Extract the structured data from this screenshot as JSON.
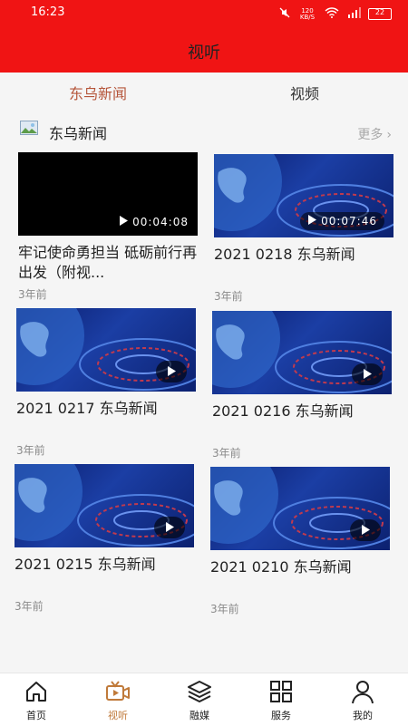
{
  "status_bar": {
    "time": "16:23",
    "net_speed": "120 KB/S",
    "battery": "22"
  },
  "header": {
    "title": "视听"
  },
  "tabs": [
    {
      "label": "东乌新闻",
      "active": true
    },
    {
      "label": "视频",
      "active": false
    }
  ],
  "section": {
    "title": "东乌新闻",
    "more_label": "更多",
    "icon": "image-icon"
  },
  "videos": [
    {
      "title": "牢记使命勇担当  砥砺前行再出发（附视...",
      "meta": "3年前",
      "duration": "00:04:08",
      "thumb": "black"
    },
    {
      "title": "2021  0218  东乌新闻",
      "meta": "3年前",
      "duration": "00:07:46",
      "thumb": "globe"
    },
    {
      "title": "2021  0217  东乌新闻",
      "meta": "3年前",
      "duration": "",
      "thumb": "globe"
    },
    {
      "title": "2021  0216  东乌新闻",
      "meta": "3年前",
      "duration": "",
      "thumb": "globe"
    },
    {
      "title": "2021  0215  东乌新闻",
      "meta": "3年前",
      "duration": "",
      "thumb": "globe"
    },
    {
      "title": "2021  0210  东乌新闻",
      "meta": "3年前",
      "duration": "",
      "thumb": "globe"
    }
  ],
  "bottom_nav": [
    {
      "label": "首页",
      "icon": "home-icon",
      "active": false
    },
    {
      "label": "视听",
      "icon": "video-icon",
      "active": true
    },
    {
      "label": "融媒",
      "icon": "layers-icon",
      "active": false
    },
    {
      "label": "服务",
      "icon": "grid-icon",
      "active": false
    },
    {
      "label": "我的",
      "icon": "user-icon",
      "active": false
    }
  ],
  "colors": {
    "header": "#f01414",
    "accent": "#b5553a",
    "nav_active": "#c07a3a"
  }
}
